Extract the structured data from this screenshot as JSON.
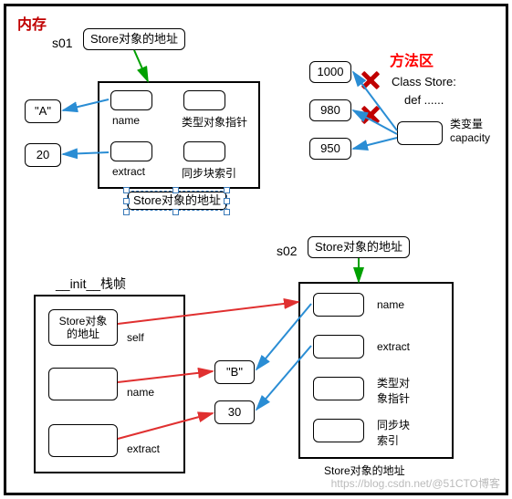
{
  "heap_label": "内存",
  "s01_label": "s01",
  "s02_label": "s02",
  "store_addr_label": "Store对象的地址",
  "store_addr_label_multiline": "Store对象\n的地址",
  "value_A": "\"A\"",
  "value_20": "20",
  "value_B": "\"B\"",
  "value_30": "30",
  "field_name": "name",
  "field_type_ptr": "类型对象指针",
  "field_type_ptr_ml": "类型对\n象指针",
  "field_extract": "extract",
  "field_sync": "同步块索引",
  "field_sync_ml": "同步块\n索引",
  "method_area_label": "方法区",
  "cap_1000": "1000",
  "cap_980": "980",
  "cap_950": "950",
  "class_store_line1": "Class Store:",
  "class_store_line2": "def ......",
  "class_var_label": "类变量\ncapacity",
  "init_frame_label": "__init__栈帧",
  "self_label": "self",
  "watermark": "https://blog.csdn.net/@51CTO博客"
}
